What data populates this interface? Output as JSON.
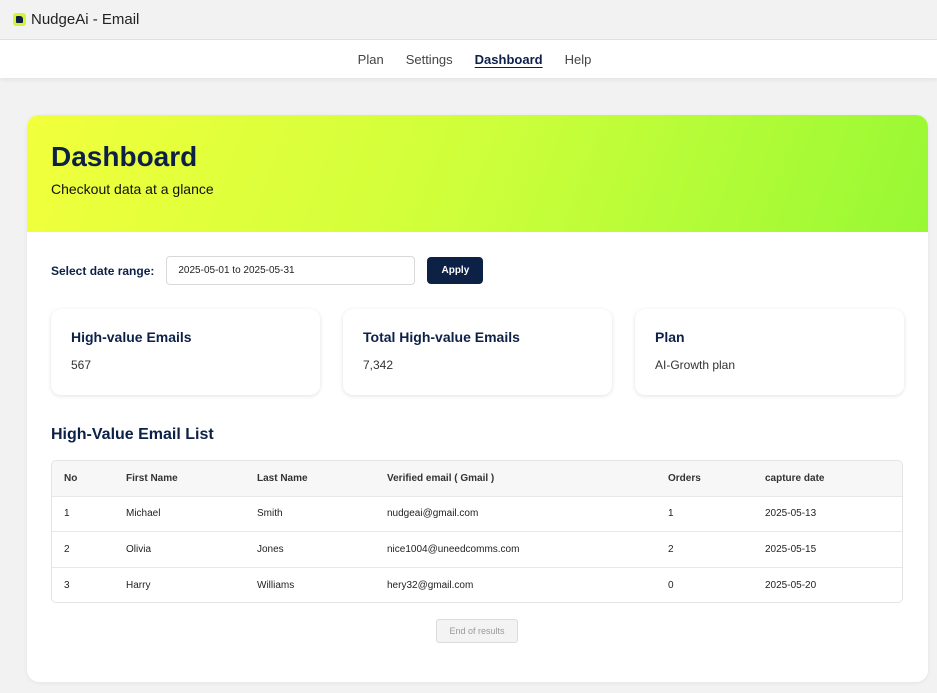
{
  "app": {
    "title": "NudgeAi - Email",
    "logo_icon": "nudgeai-logo-icon"
  },
  "nav": {
    "items": [
      {
        "label": "Plan",
        "active": false
      },
      {
        "label": "Settings",
        "active": false
      },
      {
        "label": "Dashboard",
        "active": true
      },
      {
        "label": "Help",
        "active": false
      }
    ]
  },
  "hero": {
    "title": "Dashboard",
    "subtitle": "Checkout data at a glance"
  },
  "filter": {
    "label": "Select date range:",
    "value": "2025-05-01 to 2025-05-31",
    "apply_label": "Apply"
  },
  "stats": [
    {
      "title": "High-value Emails",
      "value": "567"
    },
    {
      "title": "Total High-value Emails",
      "value": "7,342"
    },
    {
      "title": "Plan",
      "value": "AI-Growth plan"
    }
  ],
  "list": {
    "title": "High-Value Email List",
    "columns": [
      "No",
      "First Name",
      "Last Name",
      "Verified email ( Gmail )",
      "Orders",
      "capture date"
    ],
    "rows": [
      [
        "1",
        "Michael",
        "Smith",
        "nudgeai@gmail.com",
        "1",
        "2025-05-13"
      ],
      [
        "2",
        "Olivia",
        "Jones",
        "nice1004@uneedcomms.com",
        "2",
        "2025-05-15"
      ],
      [
        "3",
        "Harry",
        "Williams",
        "hery32@gmail.com",
        "0",
        "2025-05-20"
      ]
    ],
    "end_label": "End of results"
  },
  "colors": {
    "brand_navy": "#0d2147",
    "hero_start": "#f2ff3c",
    "hero_end": "#98f834"
  }
}
